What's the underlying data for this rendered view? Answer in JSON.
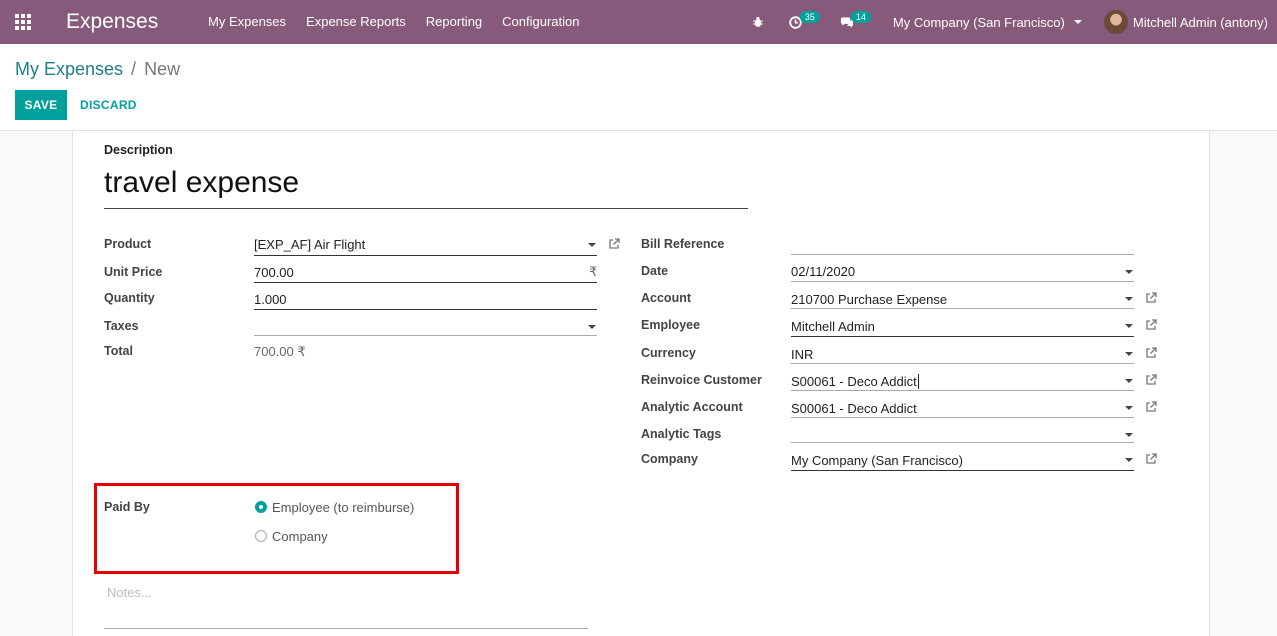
{
  "app": {
    "name": "Expenses"
  },
  "nav": {
    "menu": [
      "My Expenses",
      "Expense Reports",
      "Reporting",
      "Configuration"
    ],
    "activity_count": "35",
    "message_count": "14",
    "company": "My Company (San Francisco)",
    "user": "Mitchell Admin (antony)"
  },
  "breadcrumb": {
    "parent": "My Expenses",
    "separator": "/",
    "current": "New"
  },
  "buttons": {
    "save": "SAVE",
    "discard": "DISCARD"
  },
  "form": {
    "description_label": "Description",
    "description_value": "travel expense",
    "left": [
      {
        "label": "Product",
        "value": "[EXP_AF] Air Flight"
      },
      {
        "label": "Unit Price",
        "value": "700.00",
        "suffix": "₹"
      },
      {
        "label": "Quantity",
        "value": "1.000"
      },
      {
        "label": "Taxes",
        "value": ""
      },
      {
        "label": "Total",
        "value": "700.00 ₹"
      }
    ],
    "right": [
      {
        "label": "Bill Reference",
        "value": ""
      },
      {
        "label": "Date",
        "value": "02/11/2020"
      },
      {
        "label": "Account",
        "value": "210700 Purchase Expense"
      },
      {
        "label": "Employee",
        "value": "Mitchell Admin"
      },
      {
        "label": "Currency",
        "value": "INR"
      },
      {
        "label": "Reinvoice Customer",
        "value": "S00061 - Deco Addict"
      },
      {
        "label": "Analytic Account",
        "value": "S00061 - Deco Addict"
      },
      {
        "label": "Analytic Tags",
        "value": ""
      },
      {
        "label": "Company",
        "value": "My Company (San Francisco)"
      }
    ],
    "paid_by": {
      "label": "Paid By",
      "options": [
        "Employee (to reimburse)",
        "Company"
      ],
      "selected": "Employee (to reimburse)"
    },
    "notes_placeholder": "Notes..."
  },
  "colors": {
    "navbar": "#875a7b",
    "primary": "#00a09d",
    "highlight": "#e60000"
  }
}
